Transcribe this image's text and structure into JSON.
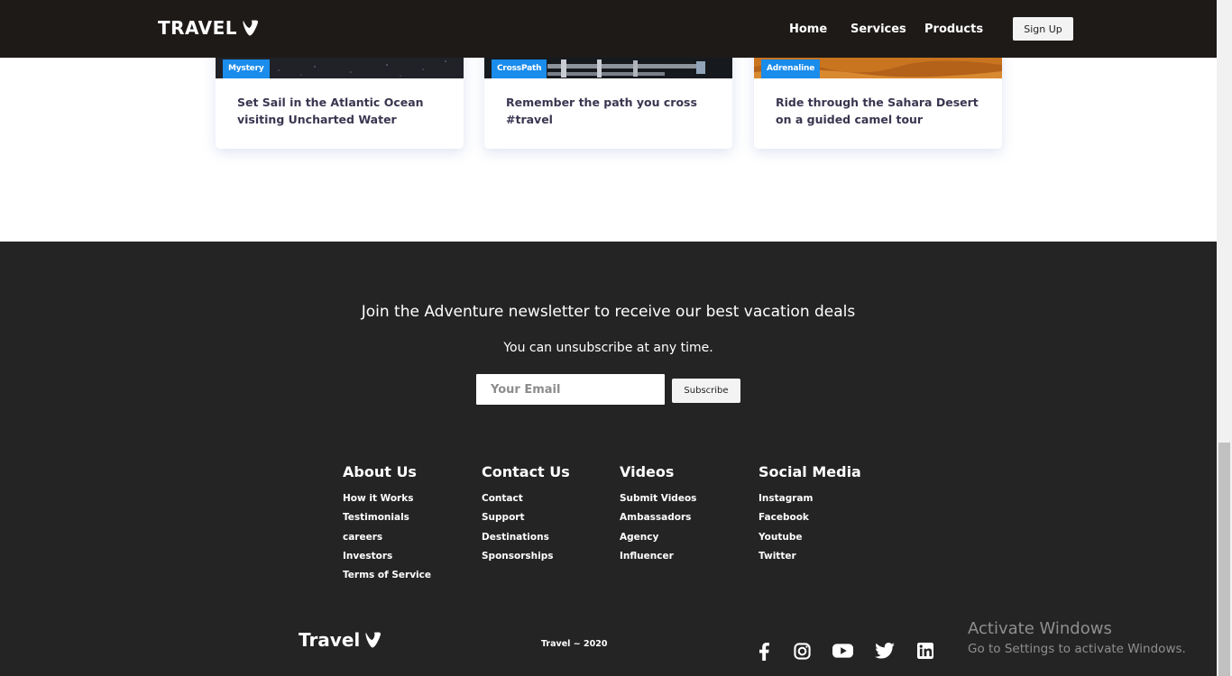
{
  "nav": {
    "brand": "TRAVEL",
    "links": [
      "Home",
      "Services",
      "Products"
    ],
    "signup_label": "Sign Up"
  },
  "cards": [
    {
      "badge": "Mystery",
      "title": "Set Sail in the Atlantic Ocean visiting Uncharted Water"
    },
    {
      "badge": "CrossPath",
      "title": "Remember the path you cross #travel"
    },
    {
      "badge": "Adrenaline",
      "title": "Ride through the Sahara Desert on a guided camel tour"
    }
  ],
  "newsletter": {
    "heading": "Join the Adventure newsletter to receive our best vacation deals",
    "sub": "You can unsubscribe at any time.",
    "email_placeholder": "Your Email",
    "subscribe_label": "Subscribe"
  },
  "footer": {
    "columns": [
      {
        "title": "About Us",
        "links": [
          "How it Works",
          "Testimonials",
          "careers",
          "Investors",
          "Terms of Service"
        ]
      },
      {
        "title": "Contact Us",
        "links": [
          "Contact",
          "Support",
          "Destinations",
          "Sponsorships"
        ]
      },
      {
        "title": "Videos",
        "links": [
          "Submit Videos",
          "Ambassadors",
          "Agency",
          "Influencer"
        ]
      },
      {
        "title": "Social Media",
        "links": [
          "Instagram",
          "Facebook",
          "Youtube",
          "Twitter"
        ]
      }
    ],
    "brand": "Travel",
    "copyright": "Travel ~ 2020",
    "social_icons": [
      "facebook-icon",
      "instagram-icon",
      "youtube-icon",
      "twitter-icon",
      "linkedin-icon"
    ]
  },
  "windows_watermark": {
    "title": "Activate Windows",
    "sub": "Go to Settings to activate Windows."
  },
  "colors": {
    "nav_bg": "#1e1a18",
    "footer_bg": "#242424",
    "badge_blue": "#1a8ceb",
    "card_title": "#3a3550"
  }
}
